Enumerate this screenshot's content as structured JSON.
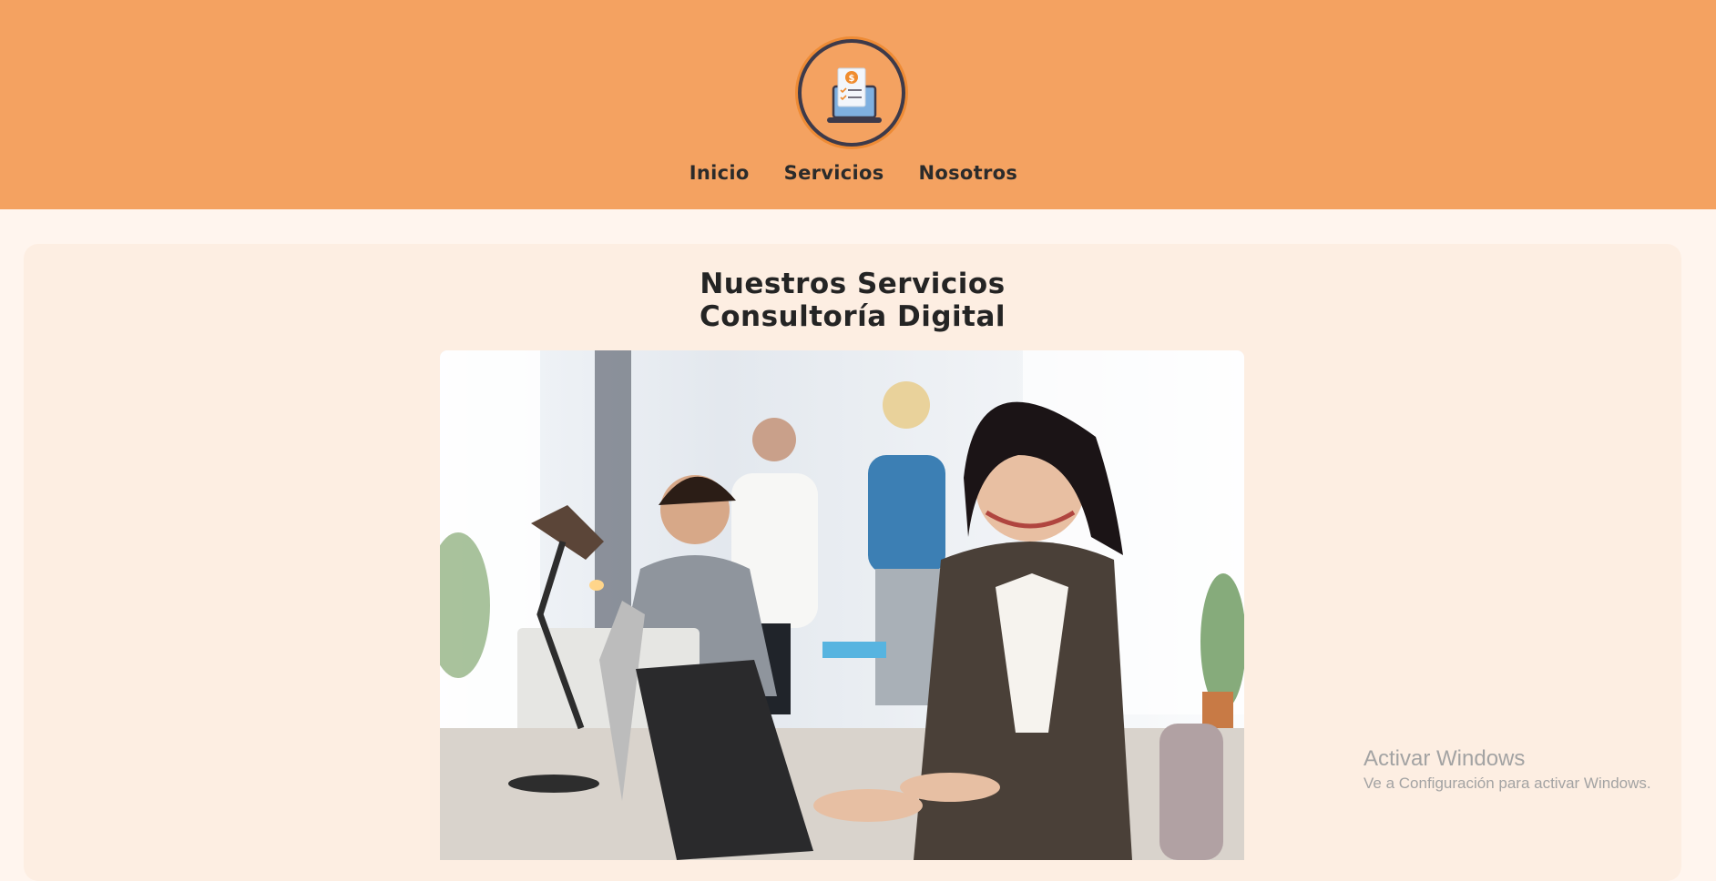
{
  "header": {
    "logo_icon": "invoice-laptop-icon",
    "logo_symbol": "$",
    "nav": [
      {
        "label": "Inicio"
      },
      {
        "label": "Servicios"
      },
      {
        "label": "Nosotros"
      }
    ]
  },
  "main": {
    "title_line1": "Nuestros Servicios",
    "title_line2": "Consultoría Digital",
    "photo_icon": "office-team-photo"
  },
  "watermark": {
    "title": "Activar Windows",
    "subtitle": "Ve a Configuración para activar Windows."
  },
  "colors": {
    "header_bg": "#f4a261",
    "page_bg": "#fff5ee",
    "card_bg": "#fdeee2",
    "text": "#2b2b2b"
  }
}
